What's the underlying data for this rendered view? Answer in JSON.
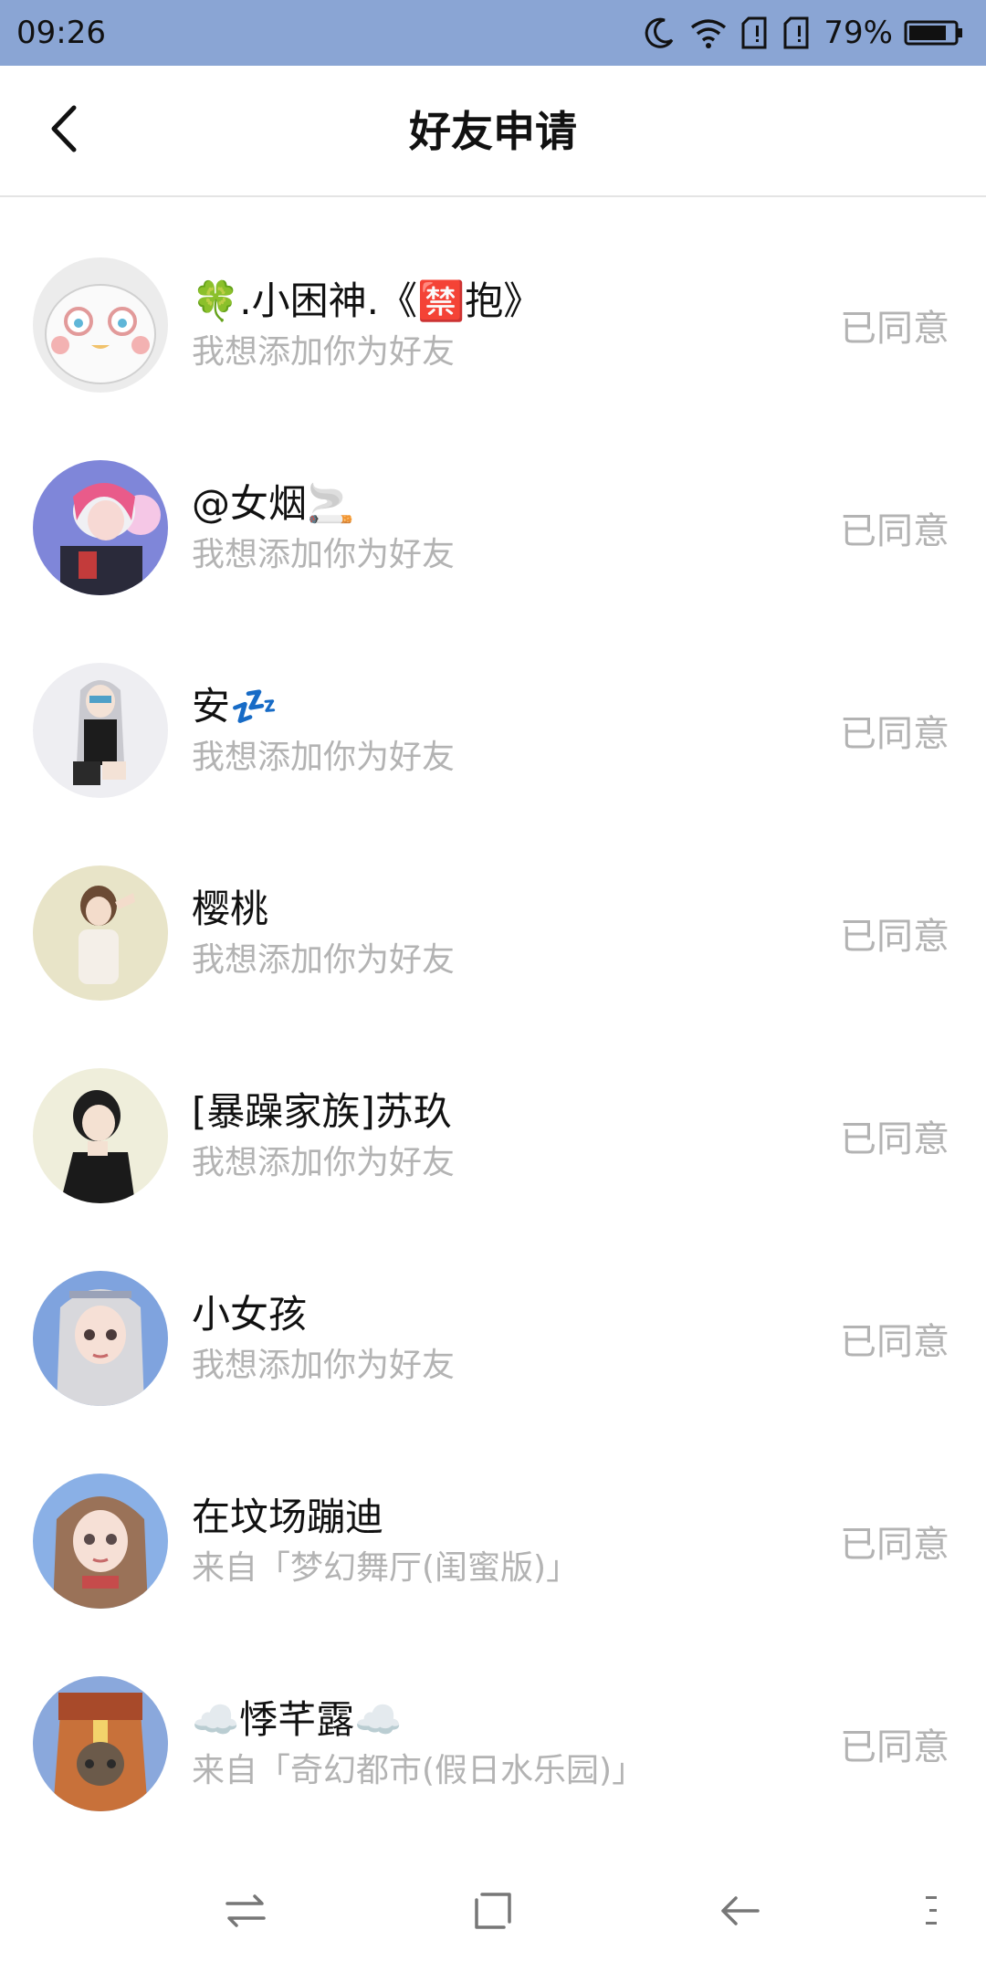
{
  "status_bar": {
    "time": "09:26",
    "battery": "79%",
    "icons": [
      "moon-icon",
      "wifi-icon",
      "sim1-icon",
      "sim2-icon",
      "battery-icon"
    ],
    "background": "#8aa5d4"
  },
  "header": {
    "title": "好友申请",
    "back_icon": "chevron-left-icon"
  },
  "requests": [
    {
      "name": "🍀.小困神.《🈲抱》",
      "sub": "我想添加你为好友",
      "status": "已同意"
    },
    {
      "name": "@女烟🚬",
      "sub": "我想添加你为好友",
      "status": "已同意"
    },
    {
      "name": "安💤",
      "sub": "我想添加你为好友",
      "status": "已同意"
    },
    {
      "name": "樱桃",
      "sub": "我想添加你为好友",
      "status": "已同意"
    },
    {
      "name": "[暴躁家族]苏玖",
      "sub": "我想添加你为好友",
      "status": "已同意"
    },
    {
      "name": "小女孩",
      "sub": "我想添加你为好友",
      "status": "已同意"
    },
    {
      "name": "在坟场蹦迪",
      "sub": "来自「梦幻舞厅(闺蜜版)」",
      "status": "已同意"
    },
    {
      "name": "☁️悸芊露☁️",
      "sub": "来自「奇幻都市(假日水乐园)」",
      "status": "已同意"
    }
  ],
  "bottom_nav": {
    "icons": [
      "switch-icon",
      "home-square-icon",
      "back-arrow-icon",
      "menu-dots-icon"
    ]
  },
  "colors": {
    "accent": "#8aa5d4",
    "secondary_text": "#b3b3b3",
    "primary_text": "#111111"
  }
}
